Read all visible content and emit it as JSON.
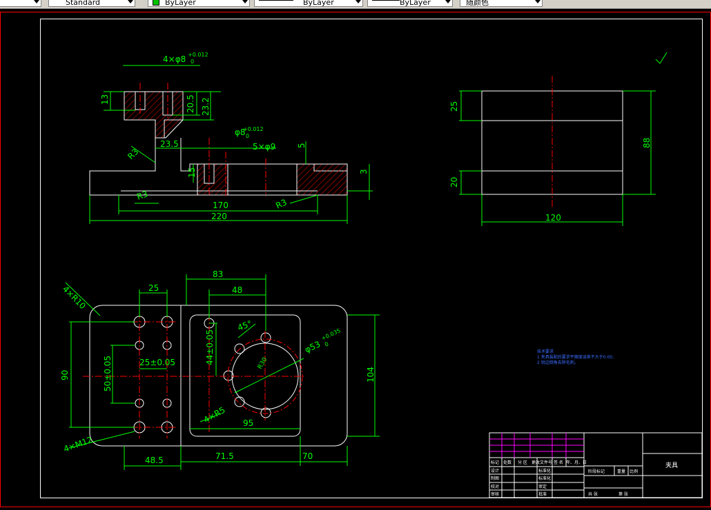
{
  "toolbar": {
    "text_style": "Standard",
    "color": "ByLayer",
    "linetype": "ByLayer",
    "lineweight": "ByLayer",
    "plot_style": "随颜色"
  },
  "dims": {
    "hole_label": "4×φ8",
    "hole_tol_up": "+0.012",
    "hole_tol_lo": "0",
    "d13": "13",
    "d20_5": "20.5",
    "d23_2": "23.2",
    "r3a": "R3",
    "d23_5": "23.5",
    "pin_label": "φ8",
    "pin_tol_up": "+0.012",
    "pin_tol_lo": "0",
    "holes5": "5×φ9",
    "d5": "5",
    "d15": "15",
    "d3": "3",
    "r3b": "R3",
    "r3c": "R3",
    "d170": "170",
    "d220": "220",
    "d25": "25",
    "d20": "20",
    "d88": "88",
    "d120": "120",
    "r10": "4×R10",
    "d83": "83",
    "d25b": "25",
    "d48": "48",
    "ang45": "45°",
    "d44": "44±0.05",
    "d50": "50±0.05",
    "d25_05": "25±0.05",
    "d90": "90",
    "d104": "104",
    "bore_label": "φ53",
    "bore_tol_up": "+0.035",
    "bore_tol_lo": "0",
    "r85": "4×R5",
    "d95": "95",
    "m12": "4×M12",
    "d48_5": "48.5",
    "d71_5": "71.5",
    "d70": "70",
    "r30": "R30"
  },
  "notes": {
    "title": "技术要求",
    "line1": "1 夹具装配后要求平面度误差不大于0.05;",
    "line2": "2 锐边倒角去除毛刺。"
  },
  "titleblock": {
    "r1": [
      "标记",
      "处数",
      "分 区",
      "更改文件号",
      "签 名",
      "年、月、日"
    ],
    "r2": [
      "设计",
      "",
      "标准化"
    ],
    "r3": [
      "制图",
      "",
      "标准化"
    ],
    "r4": [
      "校对",
      "",
      "审定"
    ],
    "r5": [
      "审核",
      "",
      "批准"
    ],
    "stage": "阶段标记",
    "weight": "重量",
    "scale": "比例",
    "sheets": "共 张",
    "sheet": "第 张",
    "name": "夹具"
  }
}
